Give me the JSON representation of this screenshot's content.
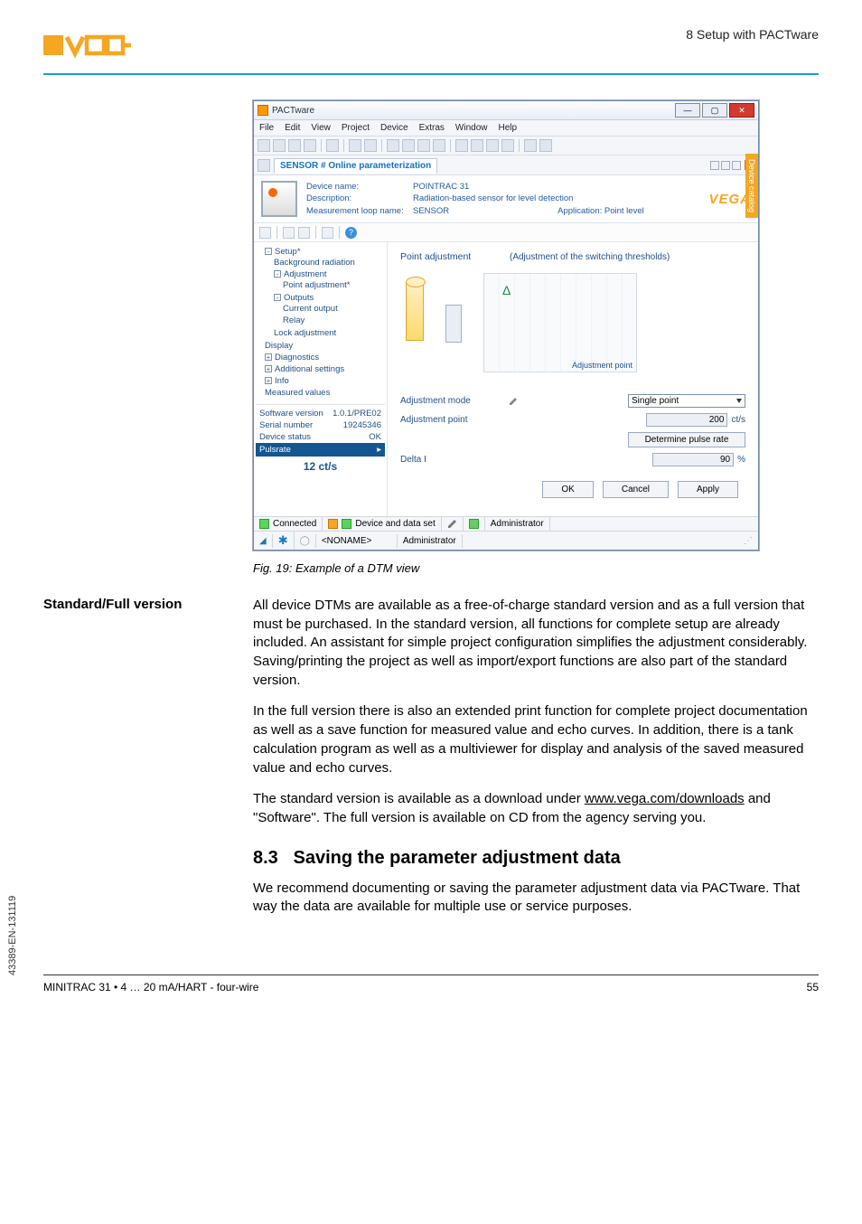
{
  "header": {
    "chapter": "8 Setup with PACTware"
  },
  "window": {
    "title": "PACTware",
    "menus": [
      "File",
      "Edit",
      "View",
      "Project",
      "Device",
      "Extras",
      "Window",
      "Help"
    ],
    "tab": "SENSOR # Online parameterization",
    "side_tab": "Device catalog",
    "device": {
      "name_label": "Device name:",
      "name": "POINTRAC 31",
      "desc_label": "Description:",
      "desc": "Radiation-based sensor for level detection",
      "loop_label": "Measurement loop name:",
      "loop": "SENSOR",
      "app_label": "Application:",
      "app": "Point level",
      "brand": "VEGA"
    },
    "tree": {
      "setup": "Setup*",
      "background": "Background radiation",
      "adjustment": "Adjustment",
      "point_adj": "Point adjustment*",
      "outputs": "Outputs",
      "current_output": "Current output",
      "relay": "Relay",
      "lock_adj": "Lock adjustment",
      "display": "Display",
      "diagnostics": "Diagnostics",
      "addl": "Additional settings",
      "info": "Info",
      "measured": "Measured values",
      "sw_ver_lbl": "Software version",
      "sw_ver": "1.0.1/PRE02",
      "serial_lbl": "Serial number",
      "serial": "19245346",
      "status_lbl": "Device status",
      "status": "OK",
      "pulsrate_lbl": "Pulsrate",
      "pulsrate_val": "12 ct/s"
    },
    "rpane": {
      "title": "Point adjustment",
      "subtitle": "(Adjustment of the switching thresholds)",
      "axis_label": "Adjustment point",
      "delta_symbol": "Δ",
      "mode_lbl": "Adjustment mode",
      "mode_val": "Single point",
      "point_lbl": "Adjustment point",
      "point_val": "200",
      "point_unit": "ct/s",
      "rate_btn": "Determine pulse rate",
      "delta_lbl": "Delta I",
      "delta_val": "90",
      "delta_unit": "%",
      "ok": "OK",
      "cancel": "Cancel",
      "apply": "Apply"
    },
    "status1": {
      "connected": "Connected",
      "dataset": "Device and data set",
      "admin": "Administrator"
    },
    "status2": {
      "noname": "<NONAME>",
      "admin": "Administrator"
    }
  },
  "caption": "Fig. 19: Example of a DTM view",
  "left_label": "Standard/Full version",
  "para1": "All device DTMs are available as a free-of-charge standard version and as a full version that must be purchased. In the standard version, all functions for complete setup are already included. An assistant for simple project configuration simplifies the adjustment considerably. Saving/printing the project as well as import/export functions are also part of the standard version.",
  "para2": "In the full version there is also an extended print function for complete project documentation as well as a save function for measured value and echo curves. In addition, there is a tank calculation program as well as a multiviewer for display and analysis of the saved measured value and echo curves.",
  "para3_pre": "The standard version is available as a download under ",
  "para3_link": "www.vega.com/downloads",
  "para3_post": " and \"Software\". The full version is available on CD from the agency serving you.",
  "section": {
    "num": "8.3",
    "title": "Saving the parameter adjustment data"
  },
  "para4": "We recommend documenting or saving the parameter adjustment data via PACTware. That way the data are available for multiple use or service purposes.",
  "doc_id": "43389-EN-131119",
  "footer": {
    "left": "MINITRAC 31 • 4 … 20 mA/HART - four-wire",
    "right": "55"
  }
}
